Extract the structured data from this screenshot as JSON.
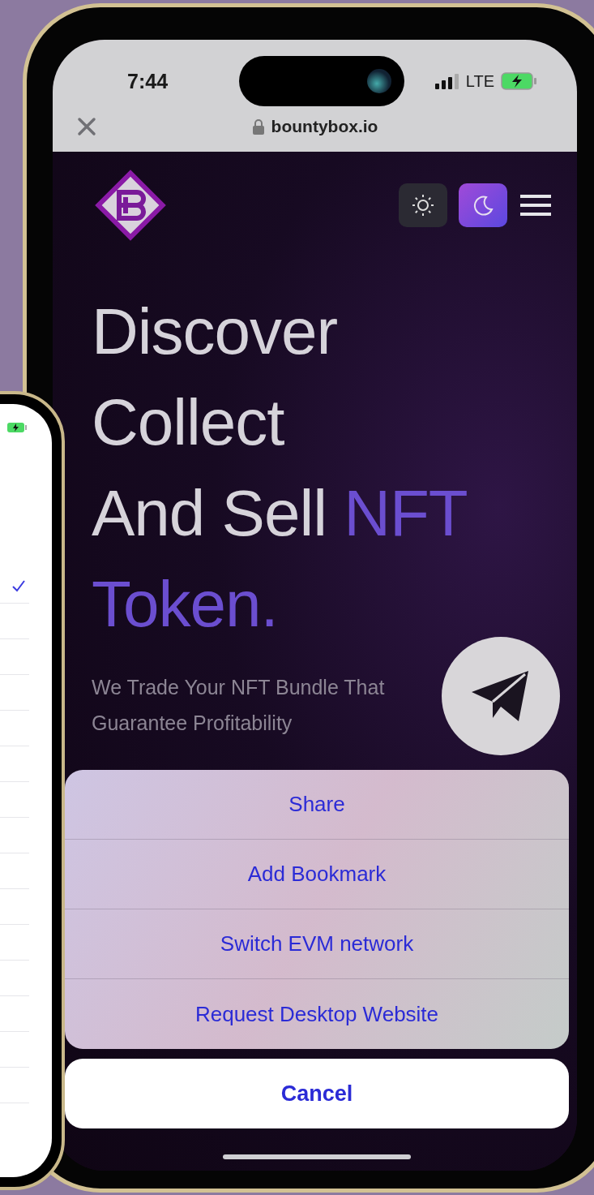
{
  "status_bar": {
    "time": "7:44",
    "network": "LTE"
  },
  "browser": {
    "url": "bountybox.io"
  },
  "header": {
    "theme_buttons": [
      {
        "kind": "light",
        "selected": false
      },
      {
        "kind": "dark",
        "selected": true
      }
    ]
  },
  "hero": {
    "headline": [
      [
        {
          "text": "Discover",
          "accent": false
        }
      ],
      [
        {
          "text": "Collect",
          "accent": false
        }
      ],
      [
        {
          "text": "And Sell ",
          "accent": false
        },
        {
          "text": "NFT",
          "accent": true
        }
      ],
      [
        {
          "text": "Token.",
          "accent": true
        }
      ]
    ],
    "subtitle": "We Trade Your NFT Bundle That Guarantee Profitability"
  },
  "action_sheet": {
    "items": [
      "Share",
      "Add Bookmark",
      "Switch EVM network",
      "Request Desktop Website"
    ],
    "cancel": "Cancel"
  },
  "back_phone": {
    "rows": [
      {
        "selected": true
      },
      {
        "selected": false
      },
      {
        "selected": false
      },
      {
        "selected": false
      },
      {
        "selected": false
      },
      {
        "selected": false
      },
      {
        "selected": false
      },
      {
        "selected": false
      },
      {
        "selected": false
      },
      {
        "selected": false
      },
      {
        "selected": false
      },
      {
        "selected": false
      },
      {
        "selected": false
      },
      {
        "selected": false
      },
      {
        "selected": false
      }
    ]
  }
}
